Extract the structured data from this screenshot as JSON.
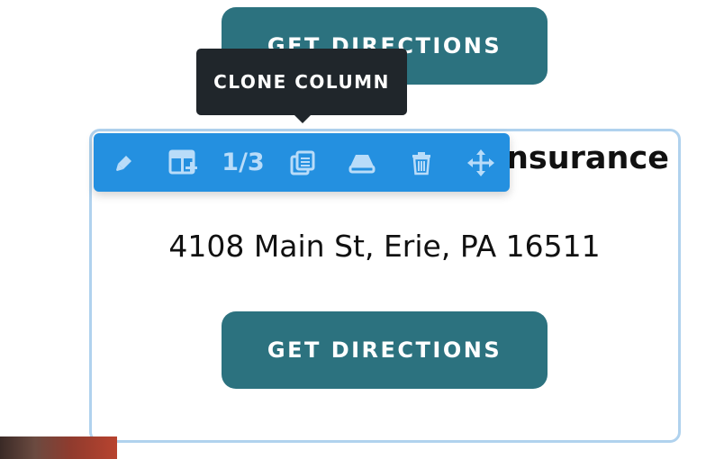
{
  "buttons": {
    "top_label": "GET DIRECTIONS",
    "bottom_label": "GET DIRECTIONS"
  },
  "column": {
    "title_visible": "nsurance",
    "address": "4108 Main St, Erie, PA 16511"
  },
  "toolbar": {
    "column_count": "1/3",
    "items": [
      {
        "icon": "pen-icon"
      },
      {
        "icon": "add-column-icon"
      },
      {
        "icon": "column-size-label"
      },
      {
        "icon": "clone-icon"
      },
      {
        "icon": "eraser-icon"
      },
      {
        "icon": "trash-icon"
      },
      {
        "icon": "move-icon"
      }
    ]
  },
  "tooltip": {
    "text": "CLONE COLUMN"
  },
  "colors": {
    "button": "#2c727f",
    "toolbar": "#2490e0",
    "toolbar_icon": "#b9dcf9",
    "column_border": "#b0d2ee",
    "tooltip": "#20262b"
  }
}
